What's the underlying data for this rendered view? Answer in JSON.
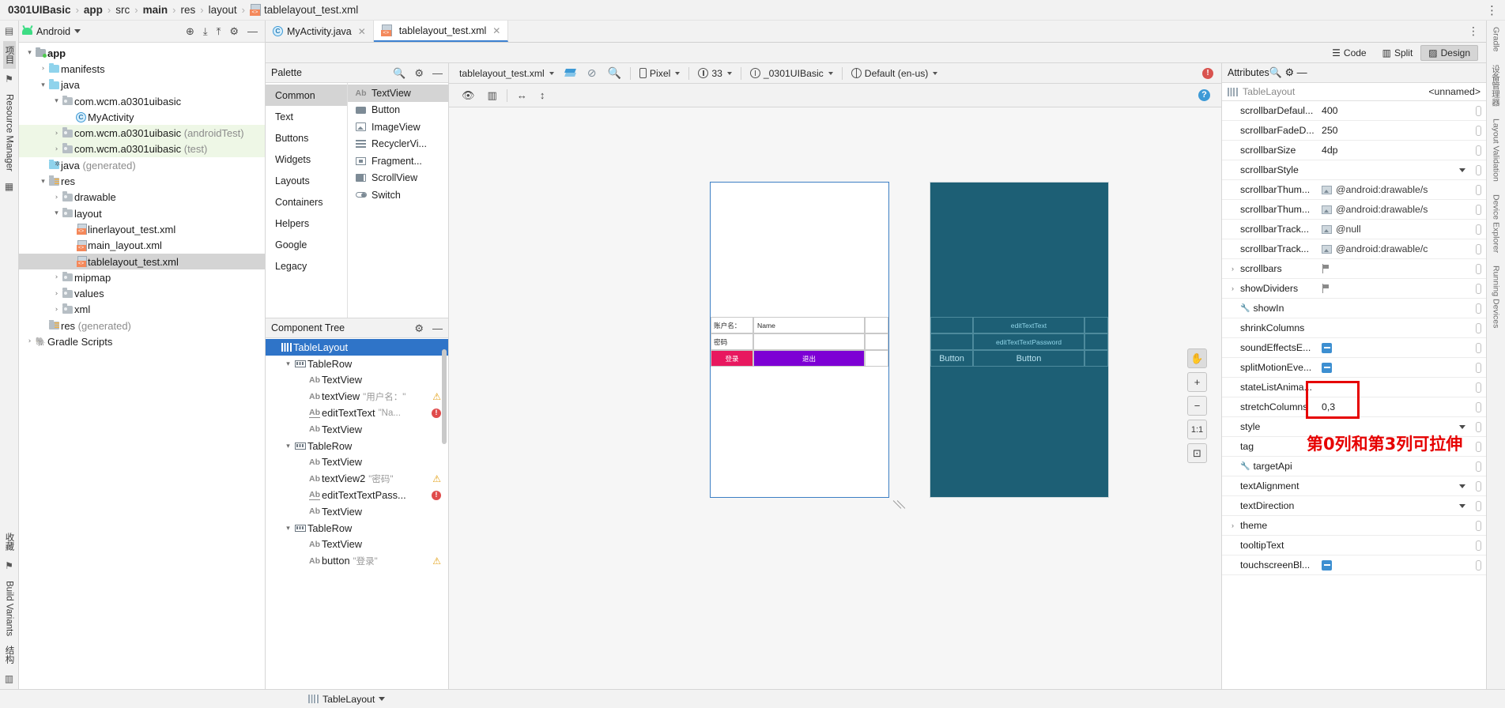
{
  "breadcrumb": {
    "items": [
      {
        "label": "0301UIBasic",
        "bold": true
      },
      {
        "label": "app",
        "bold": true
      },
      {
        "label": "src",
        "bold": false
      },
      {
        "label": "main",
        "bold": true
      },
      {
        "label": "res",
        "bold": false
      },
      {
        "label": "layout",
        "bold": false
      },
      {
        "label": "tablelayout_test.xml",
        "bold": false,
        "icon": "xml-file-icon"
      }
    ],
    "menu_icon": "vertical-dots-icon"
  },
  "left_strip": {
    "items": [
      {
        "label": "项目",
        "selected": true,
        "icon": "project-icon"
      },
      {
        "label": "",
        "icon": "bookmark-icon"
      },
      {
        "label": "Resource Manager",
        "icon": "resource-manager-icon"
      },
      {
        "label": "",
        "icon": "layers-icon"
      }
    ],
    "bottom_items": [
      {
        "label": "收藏",
        "icon": "favorites-icon"
      },
      {
        "label": "Build Variants",
        "icon": "build-variants-icon"
      },
      {
        "label": "结构",
        "icon": "structure-icon"
      }
    ]
  },
  "right_strip": {
    "items": [
      "Gradle",
      "设备管理器",
      "Layout Validation",
      "Device Explorer",
      "Running Devices"
    ]
  },
  "project_panel": {
    "title": "Android",
    "title_icon": "android-icon",
    "toolbar_icons": [
      "download-icon",
      "collapse-icon",
      "expand-icon",
      "settings-icon",
      "minimize-icon"
    ],
    "tree": [
      {
        "indent": 0,
        "arrow": "▾",
        "icon": "folder-app-icon",
        "label": "app",
        "bold": true
      },
      {
        "indent": 1,
        "arrow": "›",
        "icon": "folder-icon",
        "label": "manifests"
      },
      {
        "indent": 1,
        "arrow": "▾",
        "icon": "folder-icon",
        "label": "java"
      },
      {
        "indent": 2,
        "arrow": "▾",
        "icon": "package-icon",
        "label": "com.wcm.a0301uibasic"
      },
      {
        "indent": 3,
        "arrow": "",
        "icon": "class-icon",
        "label": "MyActivity"
      },
      {
        "indent": 2,
        "arrow": "›",
        "icon": "package-icon",
        "label": "com.wcm.a0301uibasic",
        "suffix": " (androidTest)",
        "highlight": true
      },
      {
        "indent": 2,
        "arrow": "›",
        "icon": "package-icon",
        "label": "com.wcm.a0301uibasic",
        "suffix": " (test)",
        "highlight": true
      },
      {
        "indent": 1,
        "arrow": "",
        "icon": "generated-icon",
        "label": "java",
        "suffix": " (generated)"
      },
      {
        "indent": 1,
        "arrow": "▾",
        "icon": "res-icon",
        "label": "res"
      },
      {
        "indent": 2,
        "arrow": "›",
        "icon": "package-icon",
        "label": "drawable"
      },
      {
        "indent": 2,
        "arrow": "▾",
        "icon": "package-icon",
        "label": "layout"
      },
      {
        "indent": 3,
        "arrow": "",
        "icon": "xml-file-icon",
        "label": "linerlayout_test.xml"
      },
      {
        "indent": 3,
        "arrow": "",
        "icon": "xml-file-icon",
        "label": "main_layout.xml"
      },
      {
        "indent": 3,
        "arrow": "",
        "icon": "xml-file-icon",
        "label": "tablelayout_test.xml",
        "selected": true
      },
      {
        "indent": 2,
        "arrow": "›",
        "icon": "package-icon",
        "label": "mipmap"
      },
      {
        "indent": 2,
        "arrow": "›",
        "icon": "package-icon",
        "label": "values"
      },
      {
        "indent": 2,
        "arrow": "›",
        "icon": "package-icon",
        "label": "xml"
      },
      {
        "indent": 1,
        "arrow": "",
        "icon": "res-icon",
        "label": "res",
        "suffix": " (generated)"
      },
      {
        "indent": 0,
        "arrow": "›",
        "icon": "gradle-icon",
        "label": "Gradle Scripts"
      }
    ]
  },
  "editor_tabs": [
    {
      "label": "MyActivity.java",
      "icon": "java-class-icon",
      "active": false,
      "closable": true
    },
    {
      "label": "tablelayout_test.xml",
      "icon": "xml-file-icon",
      "active": true,
      "closable": true
    }
  ],
  "view_modes": [
    {
      "label": "Code",
      "icon": "code-icon",
      "selected": false
    },
    {
      "label": "Split",
      "icon": "split-icon",
      "selected": false
    },
    {
      "label": "Design",
      "icon": "design-icon",
      "selected": true
    }
  ],
  "palette": {
    "title": "Palette",
    "toolbar_icons": [
      "search-icon",
      "settings-icon",
      "minimize-icon"
    ],
    "categories": [
      {
        "label": "Common",
        "selected": true
      },
      {
        "label": "Text",
        "selected": false
      },
      {
        "label": "Buttons",
        "selected": false
      },
      {
        "label": "Widgets",
        "selected": false
      },
      {
        "label": "Layouts",
        "selected": false
      },
      {
        "label": "Containers",
        "selected": false
      },
      {
        "label": "Helpers",
        "selected": false
      },
      {
        "label": "Google",
        "selected": false
      },
      {
        "label": "Legacy",
        "selected": false
      }
    ],
    "items": [
      {
        "label": "TextView",
        "icon": "ab-icon",
        "selected": true
      },
      {
        "label": "Button",
        "icon": "button-icon",
        "selected": false
      },
      {
        "label": "ImageView",
        "icon": "image-icon",
        "selected": false
      },
      {
        "label": "RecyclerVi...",
        "icon": "list-icon",
        "selected": false
      },
      {
        "label": "Fragment...",
        "icon": "fragment-icon",
        "selected": false
      },
      {
        "label": "ScrollView",
        "icon": "scrollview-icon",
        "selected": false
      },
      {
        "label": "Switch",
        "icon": "switch-icon",
        "selected": false
      }
    ]
  },
  "component_tree": {
    "title": "Component Tree",
    "toolbar_icons": [
      "settings-icon",
      "minimize-icon"
    ],
    "nodes": [
      {
        "indent": 0,
        "arrow": "",
        "icon": "tablelayout-icon",
        "label": "TableLayout",
        "value": "",
        "selected": true,
        "status": ""
      },
      {
        "indent": 1,
        "arrow": "▾",
        "icon": "tablerow-icon",
        "label": "TableRow",
        "value": "",
        "status": ""
      },
      {
        "indent": 2,
        "arrow": "",
        "icon": "ab-icon",
        "label": "TextView",
        "value": "",
        "status": ""
      },
      {
        "indent": 2,
        "arrow": "",
        "icon": "ab-icon",
        "label": "textView",
        "value": "\"用户名：\"",
        "status": "warning"
      },
      {
        "indent": 2,
        "arrow": "",
        "icon": "ab-underline-icon",
        "label": "editTextText",
        "value": "\"Na...",
        "status": "error"
      },
      {
        "indent": 2,
        "arrow": "",
        "icon": "ab-icon",
        "label": "TextView",
        "value": "",
        "status": ""
      },
      {
        "indent": 1,
        "arrow": "▾",
        "icon": "tablerow-icon",
        "label": "TableRow",
        "value": "",
        "status": ""
      },
      {
        "indent": 2,
        "arrow": "",
        "icon": "ab-icon",
        "label": "TextView",
        "value": "",
        "status": ""
      },
      {
        "indent": 2,
        "arrow": "",
        "icon": "ab-icon",
        "label": "textView2",
        "value": "\"密码\"",
        "status": "warning"
      },
      {
        "indent": 2,
        "arrow": "",
        "icon": "ab-underline-icon",
        "label": "editTextTextPass...",
        "value": "",
        "status": "error"
      },
      {
        "indent": 2,
        "arrow": "",
        "icon": "ab-icon",
        "label": "TextView",
        "value": "",
        "status": ""
      },
      {
        "indent": 1,
        "arrow": "▾",
        "icon": "tablerow-icon",
        "label": "TableRow",
        "value": "",
        "status": ""
      },
      {
        "indent": 2,
        "arrow": "",
        "icon": "ab-icon",
        "label": "TextView",
        "value": "",
        "status": ""
      },
      {
        "indent": 2,
        "arrow": "",
        "icon": "ab-icon",
        "label": "button",
        "value": "\"登录\"",
        "status": "warning"
      }
    ]
  },
  "design_toolbar": {
    "file_label": "tablelayout_test.xml",
    "icons": [
      "layers-icon",
      "no-theme-icon",
      "zoom-icon"
    ],
    "device": "Pixel",
    "api_level": "33",
    "theme": "_0301UIBasic",
    "locale": "Default (en-us)",
    "error_count": "!",
    "sub_icons": [
      "eye-icon",
      "grid-icon",
      "horizontal-arrows-icon",
      "vertical-arrows-icon"
    ],
    "help_icon": "help-icon"
  },
  "canvas": {
    "zoom_controls": [
      {
        "icon": "pan-icon",
        "label": "",
        "name": "pan-tool-button"
      },
      {
        "icon": "plus-icon",
        "label": "+",
        "name": "zoom-in-button"
      },
      {
        "icon": "minus-icon",
        "label": "−",
        "name": "zoom-out-button"
      },
      {
        "icon": "actual-size-icon",
        "label": "1:1",
        "name": "zoom-actual-button"
      },
      {
        "icon": "fit-screen-icon",
        "label": "⊡",
        "name": "zoom-fit-button"
      }
    ],
    "rendered_table": {
      "rows": [
        {
          "cells": [
            {
              "text": "账户名：",
              "type": "label"
            },
            {
              "text": "Name",
              "type": "edit"
            },
            {
              "text": "",
              "type": "spacer"
            }
          ]
        },
        {
          "cells": [
            {
              "text": "密码",
              "type": "label"
            },
            {
              "text": "",
              "type": "edit"
            },
            {
              "text": "",
              "type": "spacer"
            }
          ]
        },
        {
          "cells": [
            {
              "text": "登录",
              "type": "button-red"
            },
            {
              "text": "退出",
              "type": "button-purple"
            },
            {
              "text": "",
              "type": "spacer"
            }
          ]
        }
      ]
    },
    "blueprint_table": {
      "rows": [
        {
          "cells": [
            {
              "text": "",
              "type": "label"
            },
            {
              "text": "editTextText",
              "type": "edit"
            },
            {
              "text": "",
              "type": "spacer"
            }
          ]
        },
        {
          "cells": [
            {
              "text": "",
              "type": "label"
            },
            {
              "text": "editTextTextPassword",
              "type": "edit"
            },
            {
              "text": "",
              "type": "spacer"
            }
          ]
        },
        {
          "cells": [
            {
              "text": "Button",
              "type": "button"
            },
            {
              "text": "Button",
              "type": "button-big"
            },
            {
              "text": "",
              "type": "spacer"
            }
          ]
        }
      ]
    }
  },
  "attributes": {
    "title": "Attributes",
    "toolbar_icons": [
      "search-icon",
      "settings-icon",
      "minimize-icon"
    ],
    "selected_component": "TableLayout",
    "selected_id": "<unnamed>",
    "rows": [
      {
        "name": "scrollbarDefaul...",
        "value": "400",
        "type": "text",
        "dim": true
      },
      {
        "name": "scrollbarFadeD...",
        "value": "250",
        "type": "text",
        "dim": true
      },
      {
        "name": "scrollbarSize",
        "value": "4dp",
        "type": "text",
        "dim": true
      },
      {
        "name": "scrollbarStyle",
        "value": "",
        "type": "combo"
      },
      {
        "name": "scrollbarThum...",
        "value": "@android:drawable/s",
        "type": "drawable",
        "dim": true
      },
      {
        "name": "scrollbarThum...",
        "value": "@android:drawable/s",
        "type": "drawable",
        "dim": true
      },
      {
        "name": "scrollbarTrack...",
        "value": "@null",
        "type": "drawable",
        "dim": true
      },
      {
        "name": "scrollbarTrack...",
        "value": "@android:drawable/c",
        "type": "drawable",
        "dim": true
      },
      {
        "name": "scrollbars",
        "value": "",
        "type": "flag",
        "expandable": true
      },
      {
        "name": "showDividers",
        "value": "",
        "type": "flag",
        "expandable": true
      },
      {
        "name": "showIn",
        "value": "",
        "type": "text",
        "wrench": true
      },
      {
        "name": "shrinkColumns",
        "value": "",
        "type": "text"
      },
      {
        "name": "soundEffectsE...",
        "value": "",
        "type": "checkbox"
      },
      {
        "name": "splitMotionEve...",
        "value": "",
        "type": "checkbox"
      },
      {
        "name": "stateListAnima...",
        "value": "",
        "type": "text"
      },
      {
        "name": "stretchColumns",
        "value": "0,3",
        "type": "text",
        "highlighted": true
      },
      {
        "name": "style",
        "value": "",
        "type": "combo"
      },
      {
        "name": "tag",
        "value": "",
        "type": "text"
      },
      {
        "name": "targetApi",
        "value": "",
        "type": "text",
        "wrench": true
      },
      {
        "name": "textAlignment",
        "value": "",
        "type": "combo"
      },
      {
        "name": "textDirection",
        "value": "",
        "type": "combo"
      },
      {
        "name": "theme",
        "value": "",
        "type": "text",
        "expandable": true
      },
      {
        "name": "tooltipText",
        "value": "",
        "type": "text"
      },
      {
        "name": "touchscreenBl...",
        "value": "",
        "type": "checkbox"
      }
    ]
  },
  "annotations": {
    "stretch_columns_note": "第0列和第3列可拉伸",
    "highlight_color": "#e60000"
  },
  "statusbar": {
    "breadcrumb": "TableLayout",
    "icon": "tablelayout-icon",
    "caret": "▾"
  }
}
